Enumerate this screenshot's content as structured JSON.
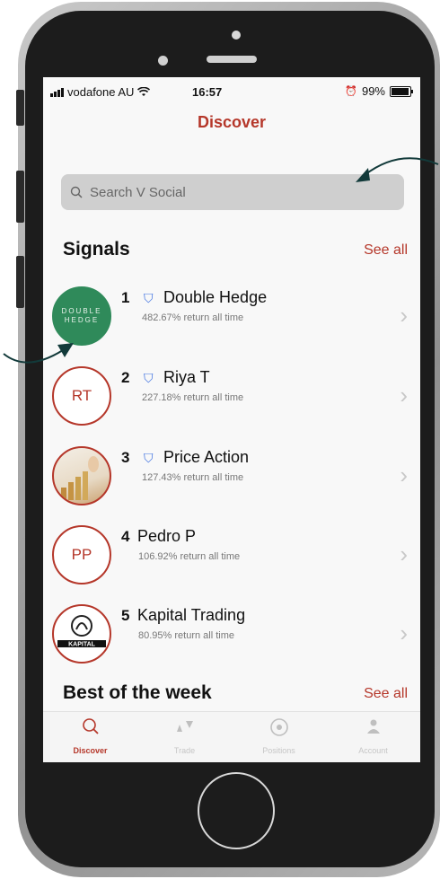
{
  "status_bar": {
    "carrier": "vodafone AU",
    "time": "16:57",
    "battery": "99%"
  },
  "header": {
    "title": "Discover"
  },
  "search": {
    "placeholder": "Search V Social"
  },
  "signals": {
    "heading": "Signals",
    "see_all": "See all",
    "items": [
      {
        "rank": "1",
        "name": "Double Hedge",
        "subtitle": "482.67% return all time",
        "bookmarked": true,
        "avatar_text": "DOUBLE HEDGE"
      },
      {
        "rank": "2",
        "name": "Riya T",
        "subtitle": "227.18% return all time",
        "bookmarked": true,
        "avatar_text": "RT"
      },
      {
        "rank": "3",
        "name": "Price Action",
        "subtitle": "127.43% return all time",
        "bookmarked": true,
        "avatar_text": ""
      },
      {
        "rank": "4",
        "name": "Pedro P",
        "subtitle": "106.92% return all time",
        "bookmarked": false,
        "avatar_text": "PP"
      },
      {
        "rank": "5",
        "name": "Kapital Trading",
        "subtitle": "80.95% return all time",
        "bookmarked": false,
        "avatar_text": "KAPITAL"
      }
    ]
  },
  "best_of_week": {
    "heading": "Best of the week",
    "see_all": "See all"
  },
  "tabs": [
    {
      "label": "Discover",
      "icon": "search-icon",
      "active": true
    },
    {
      "label": "Trade",
      "icon": "trade-icon",
      "active": false
    },
    {
      "label": "Positions",
      "icon": "positions-icon",
      "active": false
    },
    {
      "label": "Account",
      "icon": "account-icon",
      "active": false
    }
  ],
  "colors": {
    "accent": "#b5372a",
    "bookmark": "#3b6fe0",
    "double_hedge_green": "#2f8a5a"
  }
}
